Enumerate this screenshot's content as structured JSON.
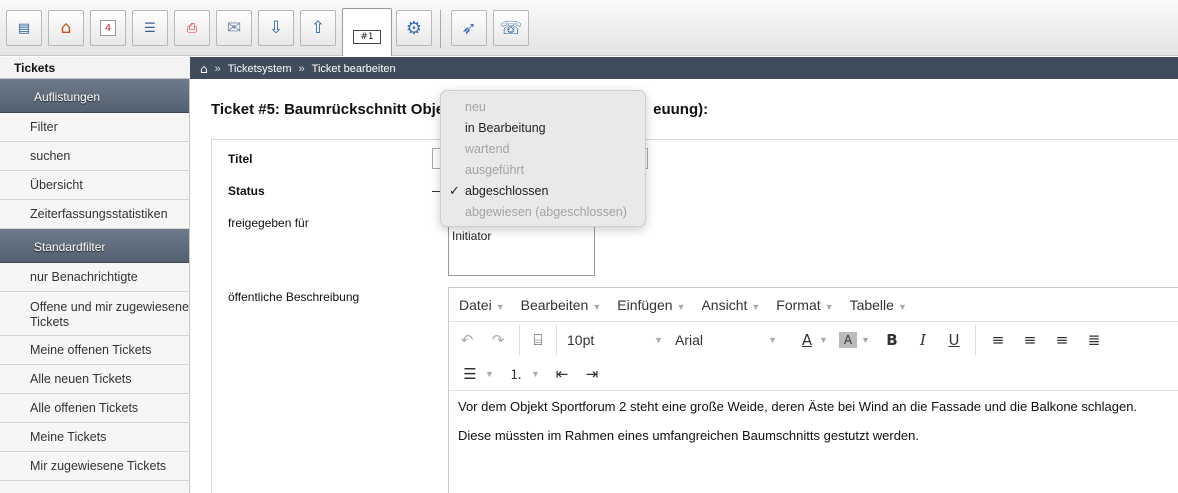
{
  "toolbar": {
    "buttons": [
      {
        "name": "contact-card-icon",
        "glyph": "▤"
      },
      {
        "name": "home-icon",
        "glyph": "⌂"
      },
      {
        "name": "calendar-icon",
        "glyph": "4"
      },
      {
        "name": "form-icon",
        "glyph": "☰"
      },
      {
        "name": "pdf-icon",
        "glyph": "⎙"
      },
      {
        "name": "mail-icon",
        "glyph": "✉"
      },
      {
        "name": "inbox-download-icon",
        "glyph": "⇩"
      },
      {
        "name": "outbox-upload-icon",
        "glyph": "⇧"
      },
      {
        "name": "ticket-icon",
        "glyph": "#1"
      },
      {
        "name": "settings-gear-icon",
        "glyph": "⚙"
      },
      {
        "name": "rocket-icon",
        "glyph": "➶"
      },
      {
        "name": "phone-icon",
        "glyph": "☏"
      }
    ]
  },
  "header": {
    "section": "Tickets",
    "breadcrumb": [
      "Ticketsystem",
      "Ticket bearbeiten"
    ],
    "breadcrumb_sep": "»",
    "home_glyph": "⌂"
  },
  "sidebar": {
    "group1": "Auflistungen",
    "items1": [
      "Filter",
      "suchen",
      "Übersicht",
      "Zeiterfassungsstatistiken"
    ],
    "group2": "Standardfilter",
    "items2": [
      "nur Benachrichtigte",
      "Offene und mir zugewiesene Tickets",
      "Meine offenen Tickets",
      "Alle neuen Tickets",
      "Alle offenen Tickets",
      "Meine Tickets",
      "Mir zugewiesene Tickets"
    ]
  },
  "main": {
    "title_left": "Ticket #5: Baumrückschnitt Obje",
    "title_right": "euung):",
    "labels": {
      "titel": "Titel",
      "status": "Status",
      "freigegeben": "freigegeben für",
      "beschreibung": "öffentliche Beschreibung"
    },
    "freigegeben_value": "Initiator"
  },
  "status_dropdown": {
    "options": [
      {
        "label": "neu",
        "enabled": false,
        "selected": false
      },
      {
        "label": "in Bearbeitung",
        "enabled": true,
        "selected": false
      },
      {
        "label": "wartend",
        "enabled": false,
        "selected": false
      },
      {
        "label": "ausgeführt",
        "enabled": false,
        "selected": false
      },
      {
        "label": "abgeschlossen",
        "enabled": true,
        "selected": true
      },
      {
        "label": "abgewiesen (abgeschlossen)",
        "enabled": false,
        "selected": false
      }
    ],
    "check_glyph": "✓"
  },
  "editor": {
    "menus": [
      "Datei",
      "Bearbeiten",
      "Einfügen",
      "Ansicht",
      "Format",
      "Tabelle"
    ],
    "font_size": "10pt",
    "font_family": "Arial",
    "paragraphs": [
      "Vor dem Objekt Sportforum 2 steht eine große Weide, deren Äste bei Wind an die Fassade und die Balkone schlagen.",
      "Diese müssten im Rahmen eines umfangreichen Baumschnitts gestutzt werden."
    ]
  },
  "colors": {
    "strip": "#3e4c5c",
    "sidebar_header": "#5b6878",
    "dropdown_bg": "#e9e9e9"
  }
}
